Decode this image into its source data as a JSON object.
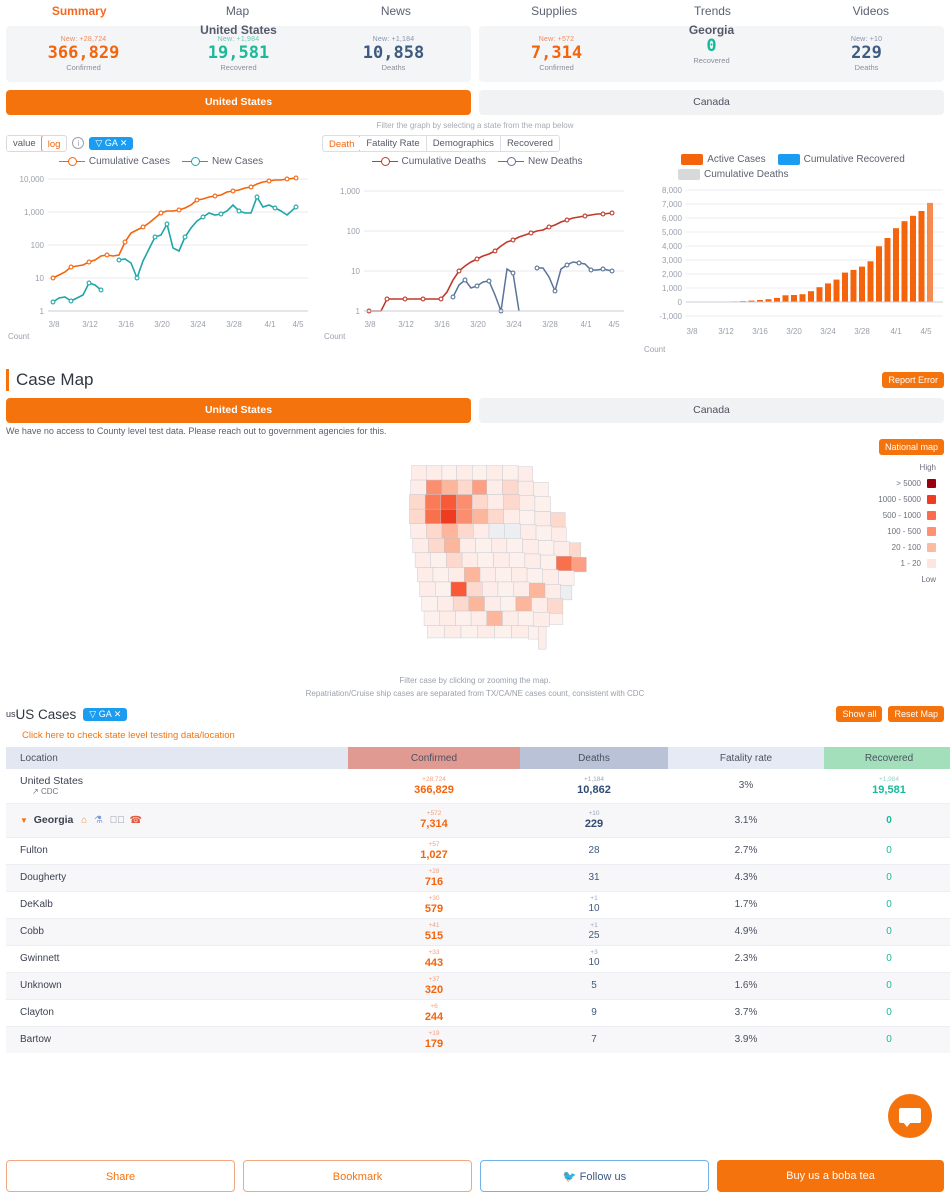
{
  "nav": {
    "items": [
      {
        "label": "Summary",
        "active": true
      },
      {
        "label": "Map",
        "active": false
      },
      {
        "label": "News",
        "active": false
      },
      {
        "label": "Supplies",
        "active": false
      },
      {
        "label": "Trends",
        "active": false
      },
      {
        "label": "Videos",
        "active": false
      }
    ]
  },
  "stats": {
    "us": {
      "title": "United States",
      "cells": [
        {
          "new": "New: +28,724",
          "value": "366,829",
          "label": "Confirmed"
        },
        {
          "new": "New: +1,984",
          "value": "19,581",
          "label": "Recovered"
        },
        {
          "new": "New: +1,184",
          "value": "10,858",
          "label": "Deaths"
        }
      ]
    },
    "state": {
      "title": "Georgia",
      "cells": [
        {
          "new": "New: +572",
          "value": "7,314",
          "label": "Confirmed"
        },
        {
          "new": "",
          "value": "0",
          "label": "Recovered"
        },
        {
          "new": "New: +10",
          "value": "229",
          "label": "Deaths"
        }
      ]
    }
  },
  "country_toggle": {
    "selected": "United States",
    "other": "Canada"
  },
  "graph_hint": "Filter the graph by selecting a state from the map below",
  "controls": {
    "scale": {
      "value_label": "value",
      "log_label": "log",
      "selected": "log"
    },
    "info_icon": "i",
    "filter_chip": "GA"
  },
  "chart_data": [
    {
      "type": "line",
      "title": "Cumulative Cases / New Cases",
      "yscale": "log",
      "ylim": [
        1,
        10000
      ],
      "yticks": [
        "1",
        "10",
        "100",
        "1,000",
        "10,000"
      ],
      "xlabel": "Count",
      "ylabel": "",
      "xticks": [
        "3/8",
        "3/12",
        "3/16",
        "3/20",
        "3/24",
        "3/28",
        "4/1",
        "4/5"
      ],
      "legend": [
        {
          "name": "Cumulative Cases",
          "color": "#f4640d"
        },
        {
          "name": "New Cases",
          "color": "#1eA6a6"
        }
      ],
      "series": [
        {
          "name": "Cumulative Cases",
          "color": "#f4640d",
          "values": [
            12,
            14,
            17,
            22,
            23,
            24,
            28,
            31,
            38,
            42,
            40,
            42,
            66,
            99,
            121,
            146,
            197,
            287,
            420,
            485,
            507,
            555,
            620,
            800,
            1097,
            1247,
            1387,
            1525,
            1643,
            2001,
            2198,
            2366,
            2683,
            3032,
            3929,
            4638,
            5348,
            5831,
            6160,
            6647,
            7314
          ]
        },
        {
          "name": "New Cases",
          "color": "#1eA6a6",
          "values": [
            3,
            4,
            5,
            3,
            4,
            5,
            12,
            11,
            8,
            null,
            null,
            null,
            31,
            33,
            25,
            11,
            26,
            51,
            90,
            96,
            189,
            68,
            58,
            98,
            180,
            220,
            316,
            287,
            308,
            357,
            500,
            400,
            376,
            372,
            1097,
            700,
            750,
            640,
            560,
            370,
            540
          ]
        }
      ]
    },
    {
      "type": "line",
      "title": "Cumulative Deaths / New Deaths",
      "yscale": "log",
      "ylim": [
        1,
        1000
      ],
      "yticks": [
        "1",
        "10",
        "100",
        "1,000"
      ],
      "xlabel": "Count",
      "xticks": [
        "3/8",
        "3/12",
        "3/16",
        "3/20",
        "3/24",
        "3/28",
        "4/1",
        "4/5"
      ],
      "tabs": [
        {
          "label": "Death",
          "active": true
        },
        {
          "label": "Fatality Rate",
          "active": false
        },
        {
          "label": "Demographics",
          "active": false
        },
        {
          "label": "Recovered",
          "active": false
        }
      ],
      "legend": [
        {
          "name": "Cumulative Deaths",
          "color": "#c0392b"
        },
        {
          "name": "New Deaths",
          "color": "#5a7498"
        }
      ],
      "series": [
        {
          "name": "Cumulative Deaths",
          "color": "#c0392b",
          "values": [
            1,
            1,
            1,
            2,
            2,
            2,
            2,
            2,
            2,
            2,
            2,
            2,
            2,
            3,
            6,
            10,
            13,
            17,
            20,
            23,
            25,
            29,
            38,
            48,
            55,
            62,
            70,
            79,
            87,
            95,
            111,
            125,
            147,
            163,
            180,
            194,
            201,
            211,
            217,
            222,
            229
          ]
        },
        {
          "name": "New Deaths",
          "color": "#5a7498",
          "values": [
            null,
            null,
            null,
            1,
            null,
            null,
            1,
            null,
            null,
            null,
            null,
            null,
            null,
            3,
            5,
            6,
            3,
            4,
            6,
            6,
            2,
            1,
            14,
            9,
            null,
            null,
            15,
            14,
            12,
            4,
            19,
            23,
            26,
            27,
            25,
            24,
            10,
            10,
            11,
            10,
            10
          ]
        }
      ]
    },
    {
      "type": "bar",
      "title": "Active Cases / Cumulative Recovered / Cumulative Deaths",
      "ylim": [
        -1000,
        8000
      ],
      "yticks": [
        "-1,000",
        "0",
        "1,000",
        "2,000",
        "3,000",
        "4,000",
        "5,000",
        "6,000",
        "7,000",
        "8,000"
      ],
      "xlabel": "Count",
      "xticks": [
        "3/8",
        "3/12",
        "3/16",
        "3/20",
        "3/24",
        "3/28",
        "4/1",
        "4/5"
      ],
      "legend": [
        {
          "name": "Active Cases",
          "color": "#f4640d"
        },
        {
          "name": "Cumulative Recovered",
          "color": "#1a9cf0"
        },
        {
          "name": "Cumulative Deaths",
          "color": "#d8d9db"
        }
      ],
      "categories": [
        "3/8",
        "3/9",
        "3/10",
        "3/11",
        "3/12",
        "3/13",
        "3/14",
        "3/15",
        "3/16",
        "3/17",
        "3/18",
        "3/19",
        "3/20",
        "3/21",
        "3/22",
        "3/23",
        "3/24",
        "3/25",
        "3/26",
        "3/27",
        "3/28",
        "3/29",
        "3/30",
        "3/31",
        "4/1",
        "4/2",
        "4/3",
        "4/4",
        "4/5"
      ],
      "series": [
        {
          "name": "Active Cases",
          "color": "#f4640d",
          "values": [
            12,
            17,
            23,
            28,
            38,
            40,
            66,
            99,
            146,
            197,
            290,
            480,
            500,
            560,
            770,
            1060,
            1330,
            1600,
            2100,
            2290,
            2530,
            2910,
            3980,
            4570,
            5270,
            5770,
            6160,
            6500,
            7080
          ]
        }
      ]
    }
  ],
  "case_map": {
    "title": "Case Map",
    "report_error": "Report Error",
    "national_map": "National map",
    "country_selected": "United States",
    "country_other": "Canada",
    "note": "We have no access to County level test data. Please reach out to government agencies for this.",
    "legend": {
      "high": "High",
      "low": "Low",
      "bins": [
        {
          "label": "> 5000",
          "color": "#99000d"
        },
        {
          "label": "1000 - 5000",
          "color": "#f03b20"
        },
        {
          "label": "500 - 1000",
          "color": "#fb6a4a"
        },
        {
          "label": "100 - 500",
          "color": "#fc9272"
        },
        {
          "label": "20 - 100",
          "color": "#fcbba1"
        },
        {
          "label": "1 - 20",
          "color": "#fee5e0"
        }
      ]
    },
    "hints": [
      "Filter case by clicking or zooming the map.",
      "Repatriation/Cruise ship cases are separated from TX/CA/NE cases count, consistent with CDC"
    ]
  },
  "us_cases": {
    "prefix": "us",
    "title": "US Cases",
    "chip": "GA",
    "show_all": "Show all",
    "reset_map": "Reset Map",
    "testing_link": "Click here to check state level testing data/location"
  },
  "table": {
    "headers": [
      "Location",
      "Confirmed",
      "Deaths",
      "Fatality rate",
      "Recovered"
    ],
    "rows": [
      {
        "location": "United States",
        "sublabel": "CDC",
        "type": "country",
        "confirmed_new": "+28,724",
        "confirmed": "366,829",
        "deaths_new": "+1,184",
        "deaths": "10,862",
        "fatality": "3%",
        "recovered_new": "+1,984",
        "recovered": "19,581"
      },
      {
        "location": "Georgia",
        "type": "state",
        "expanded": true,
        "confirmed_new": "+572",
        "confirmed": "7,314",
        "deaths_new": "+10",
        "deaths": "229",
        "fatality": "3.1%",
        "recovered_new": "",
        "recovered": "0"
      },
      {
        "location": "Fulton",
        "type": "county",
        "confirmed_new": "+57",
        "confirmed": "1,027",
        "deaths_new": "",
        "deaths": "28",
        "fatality": "2.7%",
        "recovered_new": "",
        "recovered": "0"
      },
      {
        "location": "Dougherty",
        "type": "county",
        "confirmed_new": "+28",
        "confirmed": "716",
        "deaths_new": "",
        "deaths": "31",
        "fatality": "4.3%",
        "recovered_new": "",
        "recovered": "0"
      },
      {
        "location": "DeKalb",
        "type": "county",
        "confirmed_new": "+30",
        "confirmed": "579",
        "deaths_new": "+1",
        "deaths": "10",
        "fatality": "1.7%",
        "recovered_new": "",
        "recovered": "0"
      },
      {
        "location": "Cobb",
        "type": "county",
        "confirmed_new": "+41",
        "confirmed": "515",
        "deaths_new": "+1",
        "deaths": "25",
        "fatality": "4.9%",
        "recovered_new": "",
        "recovered": "0"
      },
      {
        "location": "Gwinnett",
        "type": "county",
        "confirmed_new": "+33",
        "confirmed": "443",
        "deaths_new": "+3",
        "deaths": "10",
        "fatality": "2.3%",
        "recovered_new": "",
        "recovered": "0"
      },
      {
        "location": "Unknown",
        "type": "county",
        "confirmed_new": "+37",
        "confirmed": "320",
        "deaths_new": "",
        "deaths": "5",
        "fatality": "1.6%",
        "recovered_new": "",
        "recovered": "0"
      },
      {
        "location": "Clayton",
        "type": "county",
        "confirmed_new": "+6",
        "confirmed": "244",
        "deaths_new": "",
        "deaths": "9",
        "fatality": "3.7%",
        "recovered_new": "",
        "recovered": "0"
      },
      {
        "location": "Bartow",
        "type": "county",
        "confirmed_new": "+19",
        "confirmed": "179",
        "deaths_new": "",
        "deaths": "7",
        "fatality": "3.9%",
        "recovered_new": "",
        "recovered": "0"
      }
    ]
  },
  "footer": {
    "share": "Share",
    "bookmark": "Bookmark",
    "follow": "Follow us",
    "boba": "Buy us a boba tea"
  }
}
